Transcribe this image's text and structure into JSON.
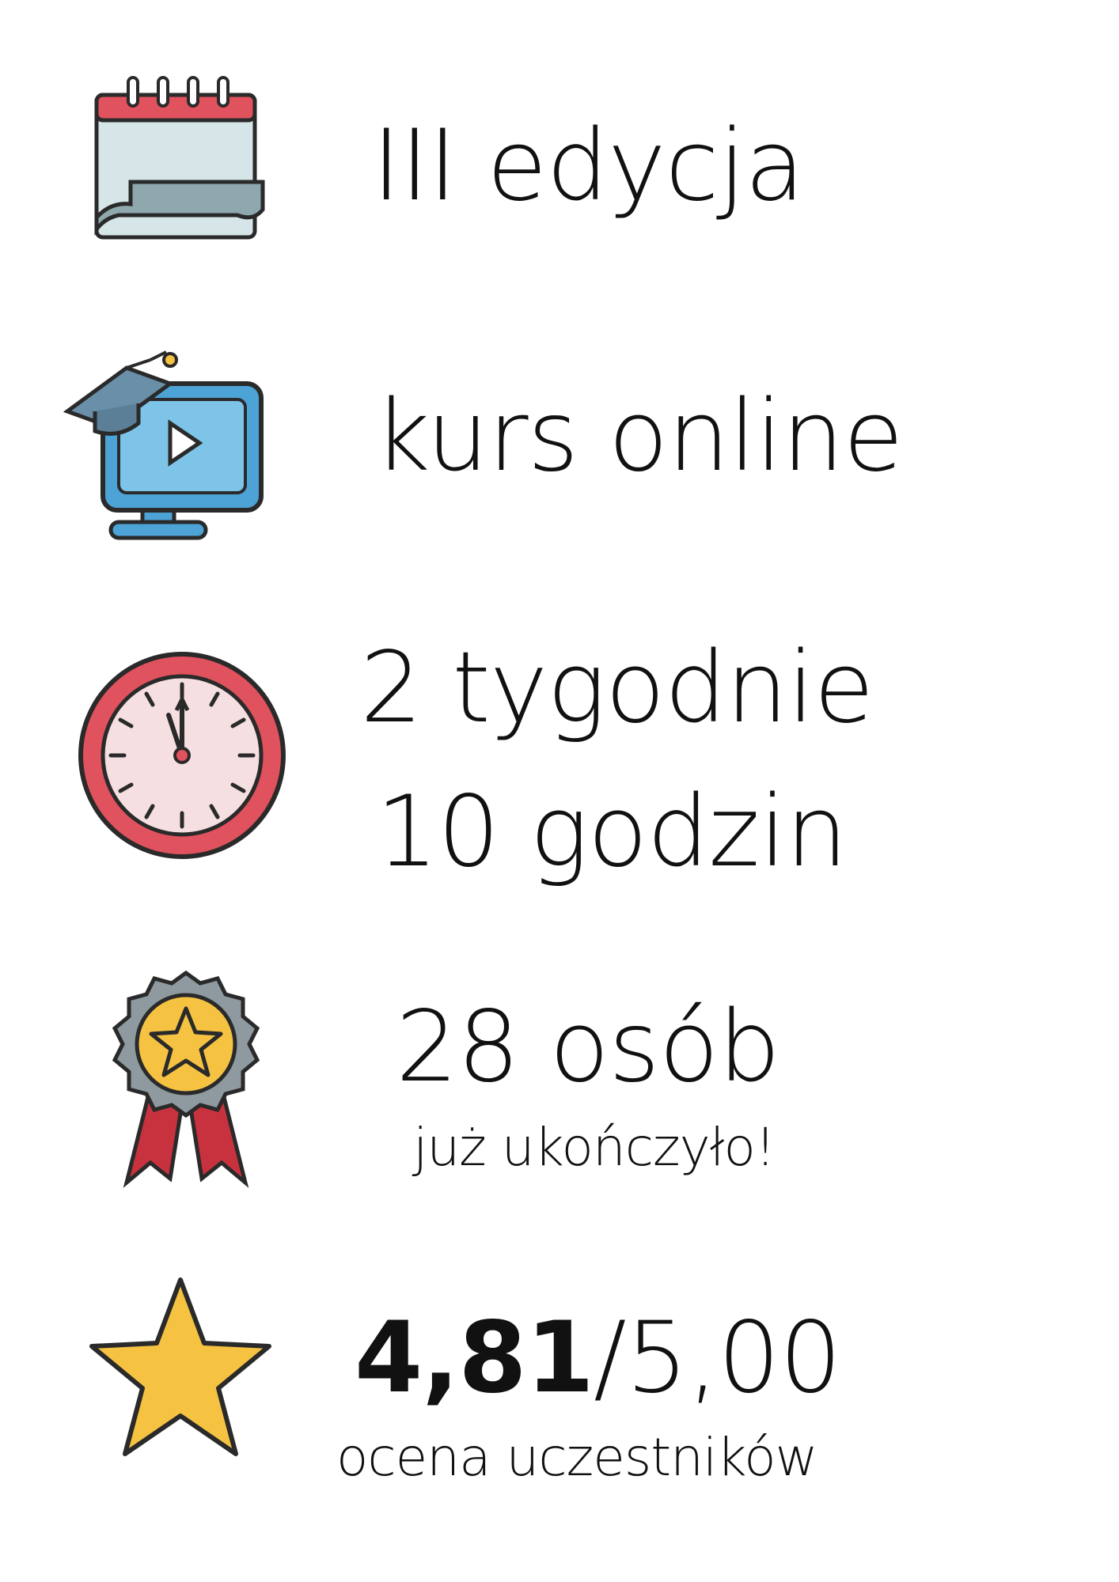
{
  "items": [
    {
      "title": "III edycja",
      "icon": "calendar-icon"
    },
    {
      "title": "kurs online",
      "icon": "online-course-monitor-icon"
    },
    {
      "title_line1": "2 tygodnie",
      "title_line2": "10 godzin",
      "icon": "clock-icon"
    },
    {
      "title": "28 osób",
      "subtitle": "już ukończyło!",
      "icon": "award-medal-icon"
    },
    {
      "score": "4,81",
      "max": "/5,00",
      "subtitle": "ocena uczestników",
      "icon": "star-icon"
    }
  ],
  "rating": {
    "value": 4.81,
    "max": 5.0
  },
  "colors": {
    "text": "#111111",
    "red": "#e0525d",
    "blue": "#4da3d6",
    "yellow": "#f5c242",
    "grey": "#8e9aa0"
  }
}
